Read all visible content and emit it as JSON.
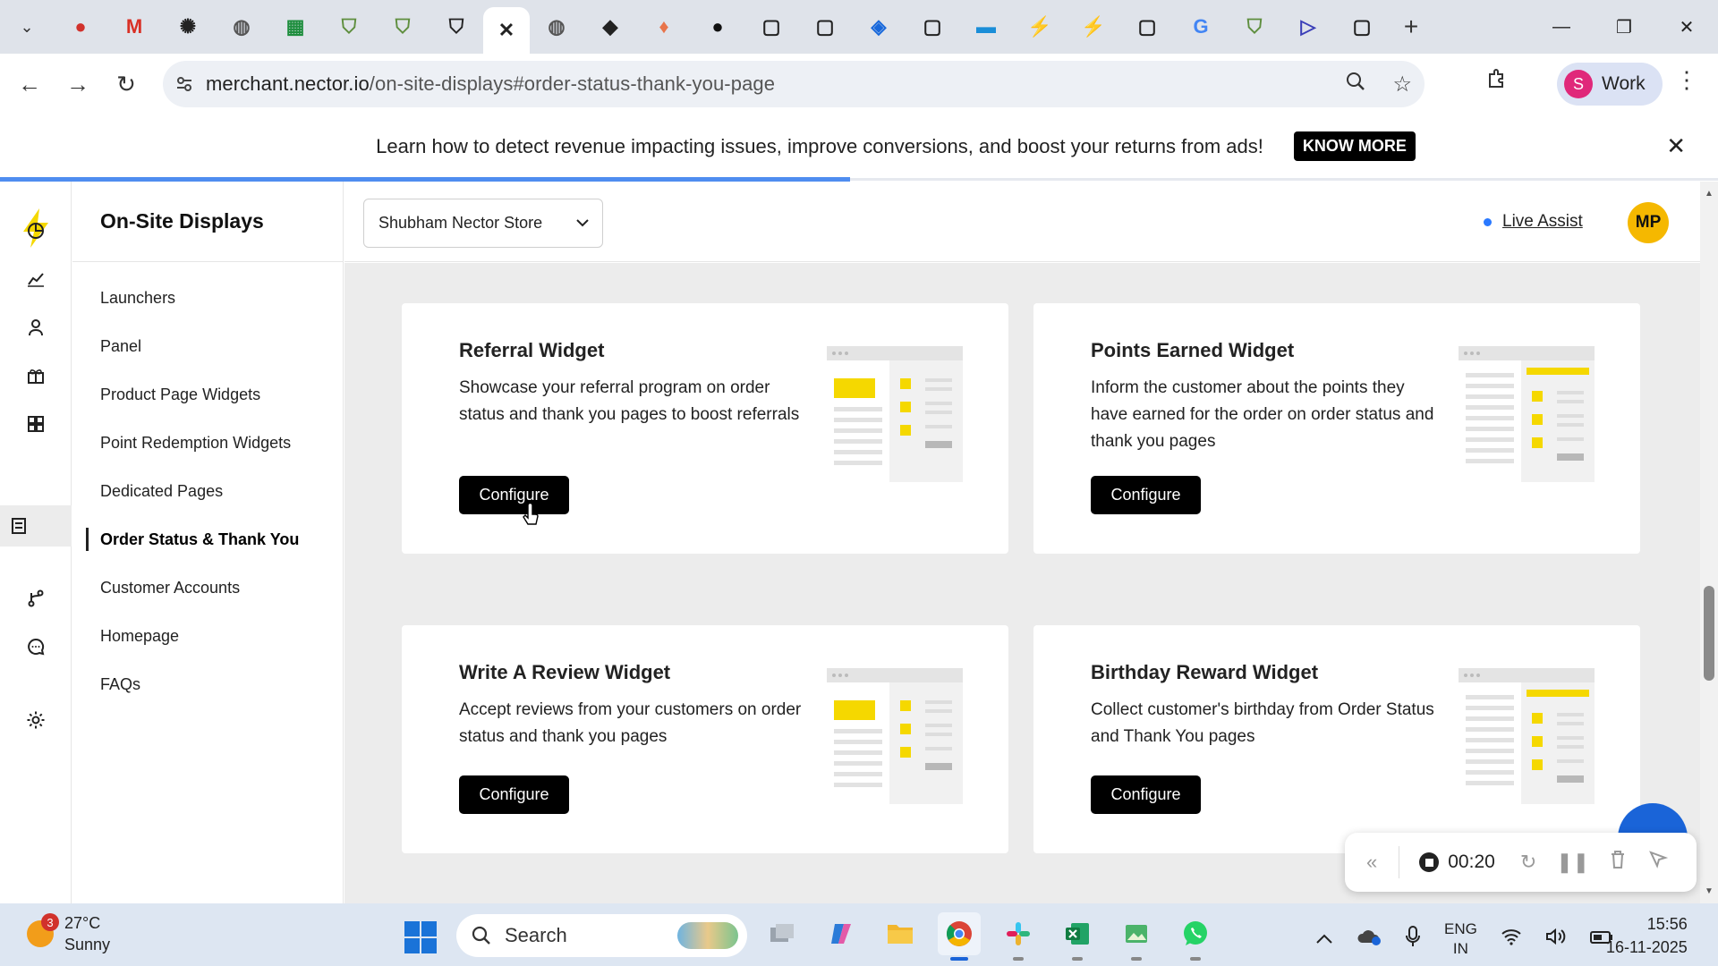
{
  "browser": {
    "url_host": "merchant.nector.io",
    "url_path": "/on-site-displays#order-status-thank-you-page",
    "profile_initial": "S",
    "profile_name": "Work",
    "tabs": [
      {
        "icon": "record-icon",
        "color": "#d1322c"
      },
      {
        "icon": "gmail-icon",
        "color": "#d93025"
      },
      {
        "icon": "openai-icon",
        "color": "#222222"
      },
      {
        "icon": "globe-icon",
        "color": "#555555"
      },
      {
        "icon": "sheets-icon",
        "color": "#1e8e3e"
      },
      {
        "icon": "shopify-icon",
        "color": "#5e8e3e"
      },
      {
        "icon": "shopify-icon",
        "color": "#5e8e3e"
      },
      {
        "icon": "shopify-icon",
        "color": "#222222"
      },
      {
        "icon": "close-icon",
        "color": "#222222",
        "active": true
      },
      {
        "icon": "globe-icon",
        "color": "#555555"
      },
      {
        "icon": "diamond-icon",
        "color": "#222222"
      },
      {
        "icon": "flame-icon",
        "color": "#e8744a"
      },
      {
        "icon": "circle-logo-icon",
        "color": "#111111"
      },
      {
        "icon": "square-icon",
        "color": "#222222"
      },
      {
        "icon": "square-icon",
        "color": "#222222"
      },
      {
        "icon": "jira-icon",
        "color": "#1868db"
      },
      {
        "icon": "square-icon",
        "color": "#222222"
      },
      {
        "icon": "chat-icon",
        "color": "#1a8ed8"
      },
      {
        "icon": "bolt-icon",
        "color": "#f5c400"
      },
      {
        "icon": "bolt-icon",
        "color": "#f5c400"
      },
      {
        "icon": "square-icon",
        "color": "#222222"
      },
      {
        "icon": "google-icon",
        "color": "#4285f4"
      },
      {
        "icon": "shopify-icon",
        "color": "#5e8e3e"
      },
      {
        "icon": "play-icon",
        "color": "#3b3fb8"
      },
      {
        "icon": "square-icon",
        "color": "#222222"
      }
    ]
  },
  "banner": {
    "text": "Learn how to detect revenue impacting issues, improve conversions, and boost your returns from ads!",
    "button": "KNOW MORE"
  },
  "sidebar": {
    "title": "On-Site Displays",
    "items": [
      {
        "label": "Launchers"
      },
      {
        "label": "Panel"
      },
      {
        "label": "Product Page Widgets"
      },
      {
        "label": "Point Redemption Widgets"
      },
      {
        "label": "Dedicated Pages"
      },
      {
        "label": "Order Status & Thank You",
        "active": true
      },
      {
        "label": "Customer Accounts"
      },
      {
        "label": "Homepage"
      },
      {
        "label": "FAQs"
      }
    ]
  },
  "header": {
    "store": "Shubham Nector Store",
    "live_assist": "Live Assist",
    "avatar": "MP"
  },
  "cards": [
    {
      "title": "Referral Widget",
      "desc": "Showcase your referral program on order status and thank you pages to boost referrals",
      "button": "Configure"
    },
    {
      "title": "Points Earned Widget",
      "desc": "Inform the customer about the points they have earned for the order on order status and thank you pages",
      "button": "Configure"
    },
    {
      "title": "Write A Review Widget",
      "desc": "Accept reviews from your customers on order status and thank you pages",
      "button": "Configure"
    },
    {
      "title": "Birthday Reward Widget",
      "desc": "Collect customer's birthday from Order Status and Thank You pages",
      "button": "Configure"
    }
  ],
  "recorder": {
    "time": "00:20"
  },
  "taskbar": {
    "weather_badge": "3",
    "temp": "27°C",
    "condition": "Sunny",
    "search": "Search",
    "lang_top": "ENG",
    "lang_bottom": "IN",
    "time": "15:56",
    "date": "16-11-2025"
  },
  "colors": {
    "brand_yellow": "#f5d800",
    "button_black": "#000000",
    "content_bg": "#ececec"
  }
}
